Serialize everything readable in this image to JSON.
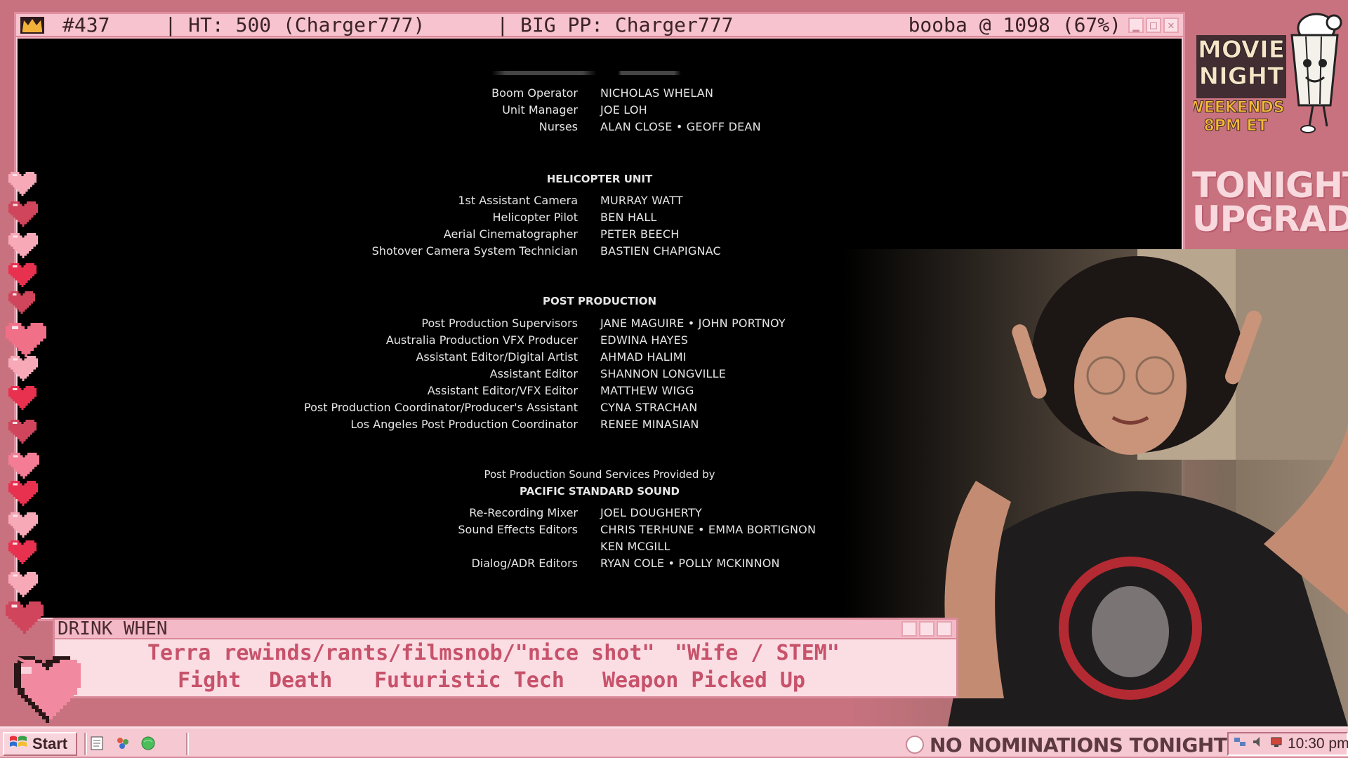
{
  "title_bar": {
    "episode": "#437",
    "ht": "| HT: 500 (Charger777)",
    "big_pp": "| BIG PP: Charger777",
    "booba": "booba @ 1098 (67%)"
  },
  "credits": {
    "block1": [
      {
        "role": "Boom Operator",
        "name": "NICHOLAS WHELAN"
      },
      {
        "role": "Unit Manager",
        "name": "JOE LOH"
      },
      {
        "role": "Nurses",
        "name": "ALAN CLOSE • GEOFF DEAN"
      }
    ],
    "helicopter_heading": "HELICOPTER UNIT",
    "helicopter": [
      {
        "role": "1st Assistant Camera",
        "name": "MURRAY WATT"
      },
      {
        "role": "Helicopter Pilot",
        "name": "BEN HALL"
      },
      {
        "role": "Aerial Cinematographer",
        "name": "PETER BEECH"
      },
      {
        "role": "Shotover Camera System Technician",
        "name": "BASTIEN CHAPIGNAC"
      }
    ],
    "post_heading": "POST PRODUCTION",
    "post": [
      {
        "role": "Post Production Supervisors",
        "name": "JANE MAGUIRE • JOHN PORTNOY"
      },
      {
        "role": "Australia Production VFX Producer",
        "name": "EDWINA HAYES"
      },
      {
        "role": "Assistant Editor/Digital Artist",
        "name": "AHMAD HALIMI"
      },
      {
        "role": "Assistant Editor",
        "name": "SHANNON LONGVILLE"
      },
      {
        "role": "Assistant Editor/VFX Editor",
        "name": "MATTHEW WIGG"
      },
      {
        "role": "Post Production Coordinator/Producer's Assistant",
        "name": "CYNA STRACHAN"
      },
      {
        "role": "Los Angeles Post Production Coordinator",
        "name": "RENEE MINASIAN"
      }
    ],
    "sound_intro": "Post Production Sound Services Provided by",
    "sound_heading": "PACIFIC STANDARD SOUND",
    "sound": [
      {
        "role": "Re-Recording Mixer",
        "name": "JOEL DOUGHERTY"
      },
      {
        "role": "Sound Effects Editors",
        "name": "CHRIS TERHUNE • EMMA BORTIGNON"
      },
      {
        "role": "",
        "name": "KEN MCGILL"
      },
      {
        "role": "Dialog/ADR Editors",
        "name": "RYAN COLE • POLLY MCKINNON"
      }
    ]
  },
  "logo": {
    "line1": "MOVIE",
    "line2": "NIGHT",
    "line3": "WEEKENDS",
    "line4": "8PM ET"
  },
  "tonight": {
    "line1": "TONIGHT:",
    "line2": "UPGRADE"
  },
  "drink_when": {
    "title": "DRINK WHEN",
    "rule1": "Terra rewinds/rants/filmsnob/\"nice shot\"",
    "rule2": "\"Wife / STEM\"",
    "rule3": "Fight",
    "rule4": "Death",
    "rule5": "Futuristic Tech",
    "rule6": "Weapon Picked Up"
  },
  "taskbar": {
    "start_label": "Start",
    "nominations": "NO NOMINATIONS TONIGHT",
    "clock": "10:30 pm"
  },
  "colors": {
    "background": "#c9727f",
    "window_pink": "#f7c3cf",
    "drink_text": "#c7526a",
    "heart_red": "#e8314f",
    "heart_pink": "#f48fa4"
  }
}
